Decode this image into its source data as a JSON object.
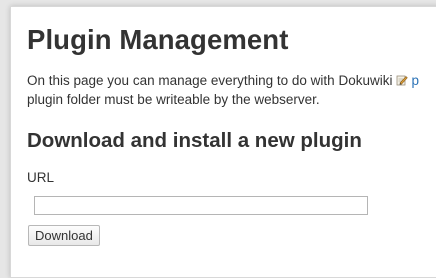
{
  "page": {
    "title": "Plugin Management",
    "intro_line1": "On this page you can manage everything to do with Dokuwiki",
    "intro_link_fragment": "p",
    "intro_line2": "plugin folder must be writeable by the webserver.",
    "section_title": "Download and install a new plugin"
  },
  "form": {
    "url_label": "URL",
    "url_value": "",
    "download_label": "Download"
  },
  "icons": {
    "pencil": "pencil-icon"
  },
  "colors": {
    "link": "#2b73b7"
  }
}
